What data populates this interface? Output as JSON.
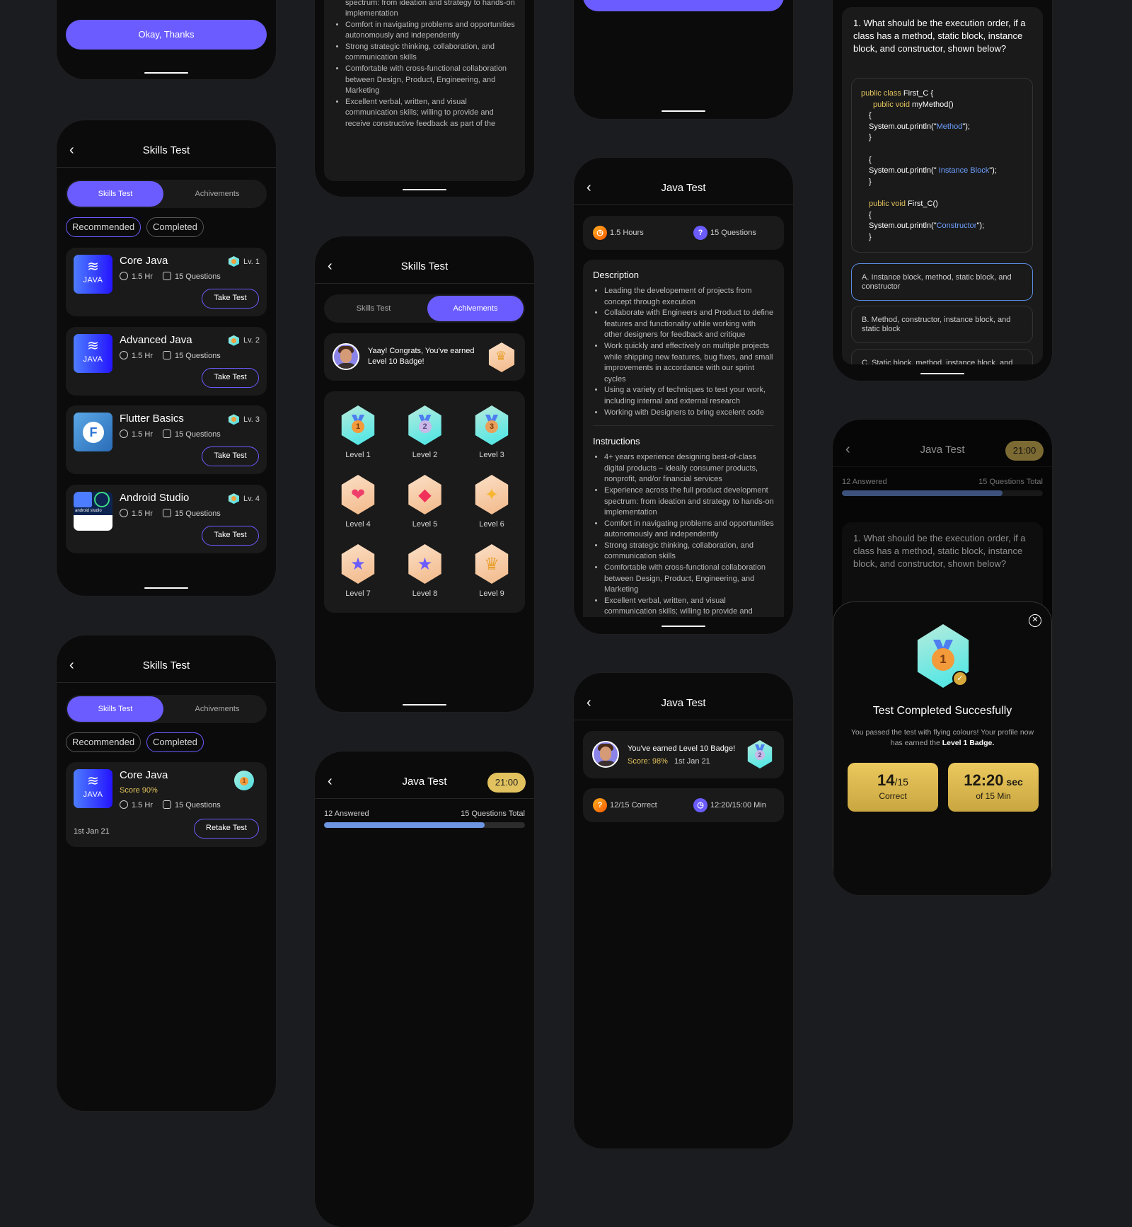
{
  "colors": {
    "accent": "#6b5cff",
    "gold": "#e2c25e",
    "background": "#1b1c1f",
    "progress": "#6d95e2",
    "selected_option": "#5b8be0"
  },
  "success_dialog_partial": {
    "button_label": "Okay, Thanks"
  },
  "skills_recommended": {
    "title": "Skills Test",
    "back_icon": "chevron-left",
    "tabs": [
      "Skills Test",
      "Achivements"
    ],
    "filters": [
      "Recommended",
      "Completed"
    ],
    "tests": [
      {
        "name": "Core Java",
        "level": "Lv. 1",
        "duration": "1.5 Hr",
        "questions": "15 Questions",
        "button": "Take Test",
        "logo": "java",
        "logo_text": "JAVA"
      },
      {
        "name": "Advanced Java",
        "level": "Lv. 2",
        "duration": "1.5 Hr",
        "questions": "15 Questions",
        "button": "Take Test",
        "logo": "java",
        "logo_text": "JAVA"
      },
      {
        "name": "Flutter Basics",
        "level": "Lv. 3",
        "duration": "1.5 Hr",
        "questions": "15 Questions",
        "button": "Take Test",
        "logo": "flutter"
      },
      {
        "name": "Android Studio",
        "level": "Lv. 4",
        "duration": "1.5 Hr",
        "questions": "15 Questions",
        "button": "Take Test",
        "logo": "android",
        "logo_text": "android studio"
      }
    ]
  },
  "skills_completed": {
    "title": "Skills Test",
    "tabs": [
      "Skills Test",
      "Achivements"
    ],
    "filters": [
      "Recommended",
      "Completed"
    ],
    "test": {
      "name": "Core Java",
      "score": "Score 90%",
      "duration": "1.5 Hr",
      "questions": "15 Questions",
      "date": "1st Jan 21",
      "button": "Retake Test",
      "logo_text": "JAVA"
    }
  },
  "achievements": {
    "title": "Skills Test",
    "tabs": [
      "Skills Test",
      "Achivements"
    ],
    "congrats": "Yaay! Congrats, You've earned Level 10 Badge!",
    "badges": [
      {
        "label": "Level 1",
        "style": "teal",
        "icon": "medal",
        "number": "1"
      },
      {
        "label": "Level 2",
        "style": "teal",
        "icon": "medal",
        "number": "2"
      },
      {
        "label": "Level 3",
        "style": "teal",
        "icon": "medal",
        "number": "3"
      },
      {
        "label": "Level 4",
        "style": "peach",
        "icon": "heart"
      },
      {
        "label": "Level 5",
        "style": "peach",
        "icon": "diamond"
      },
      {
        "label": "Level 6",
        "style": "peach",
        "icon": "sparkle"
      },
      {
        "label": "Level 7",
        "style": "peach",
        "icon": "star-medal"
      },
      {
        "label": "Level 8",
        "style": "peach",
        "icon": "star-medal"
      },
      {
        "label": "Level 9",
        "style": "peach",
        "icon": "trophy"
      }
    ]
  },
  "java_details": {
    "title": "Java Test",
    "duration": "1.5 Hours",
    "questions": "15 Questions",
    "description_heading": "Description",
    "description": [
      "Leading the developement of projects from concept through execution",
      "Collaborate with Engineers and Product to define features and functionality while working with other designers for feedback and critique",
      "Work quickly and effectively on multiple projects while shipping new features, bug fixes, and small improvements in accordance with our sprint cycles",
      "Using a variety of techniques to test your work, including internal and external research",
      "Working with Designers to bring excelent code"
    ],
    "instructions_heading": "Instructions",
    "instructions": [
      "4+ years experience designing best-of-class digital products – ideally consumer products, nonprofit, and/or financial services",
      "Experience across the full product development spectrum: from ideation and strategy to hands-on implementation",
      "Comfort in navigating problems and opportunities autonomously and independently",
      "Strong strategic thinking, collaboration, and communication skills",
      "Comfortable with cross-functional collaboration between Design, Product, Engineering, and Marketing",
      "Excellent verbal, written, and visual communication skills; willing to provide and receive constructive feedback as part of the"
    ]
  },
  "java_quiz": {
    "title": "Java Test",
    "timer": "21:00",
    "answered": "12 Answered",
    "total": "15 Questions Total",
    "progress_percent": 80,
    "question": "1. What should be the execution order, if a class has a method, static block, instance block, and constructor, shown below?",
    "code": {
      "l1_kw": "public class",
      "l1": " First_C {",
      "l2_kw": "public void",
      "l2": " myMethod()",
      "open": "{",
      "close": "}",
      "print_pre": "System.out.println(\"",
      "print_post": "\");",
      "s1": "Method",
      "s2": " Instance Block",
      "s3": "Constructor",
      "l3_kw": "public void",
      "l3": " First_C()"
    },
    "options": [
      "A. Instance block, method, static block, and constructor",
      "B. Method, constructor, instance block, and static block",
      "C. Static block, method, instance block, and constructor"
    ],
    "selected_option": 0
  },
  "java_result": {
    "title": "Java Test",
    "earned": "You've earned Level 10 Badge!",
    "score": "Score: 98%",
    "date": "1st Jan 21",
    "correct": "12/15 Correct",
    "time": "12:20/15:00 Min"
  },
  "completion_modal": {
    "title": "Test Completed Succesfully",
    "message": "You passed the test with flying colours! Your profile now has earned the ",
    "message_bold": "Level 1 Badge.",
    "stats": [
      {
        "value": "14",
        "suffix": "/15",
        "label": "Correct"
      },
      {
        "value": "12:20",
        "suffix": " sec",
        "label": "of 15 Min"
      }
    ]
  }
}
